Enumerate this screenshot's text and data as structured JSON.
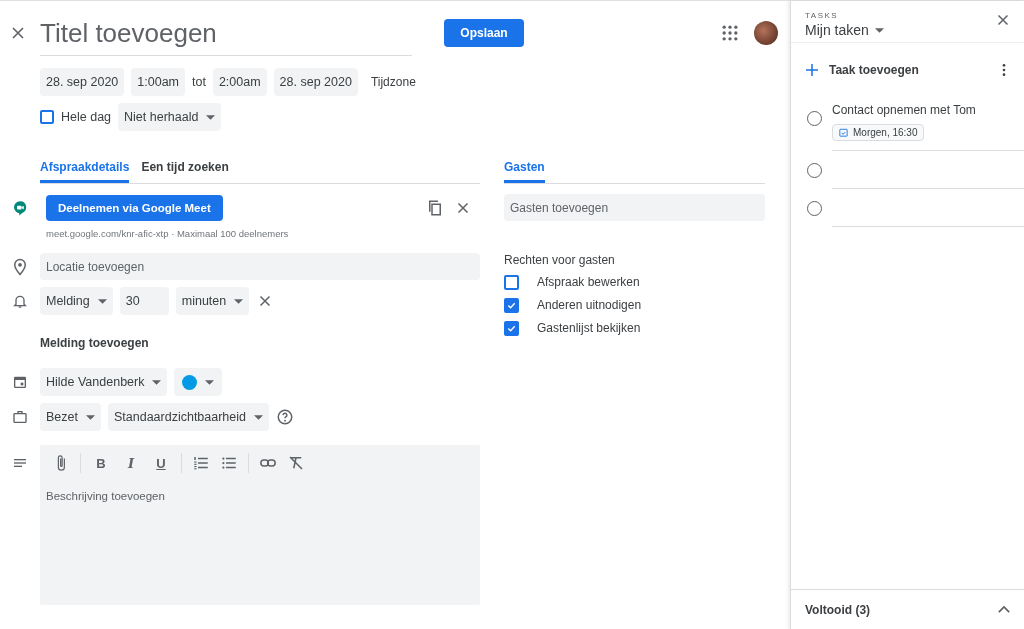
{
  "title_field": {
    "placeholder": "Titel toevoegen"
  },
  "save_button": "Opslaan",
  "time_row": {
    "start_date": "28. sep 2020",
    "start_time": "1:00am",
    "separator": "tot",
    "end_time": "2:00am",
    "end_date": "28. sep 2020",
    "timezone": "Tijdzone"
  },
  "all_day": {
    "label": "Hele dag",
    "checked": false
  },
  "repeat": "Niet herhaald",
  "tabs": [
    {
      "label": "Afspraakdetails",
      "selected": true
    },
    {
      "label": "Een tijd zoeken",
      "selected": false
    }
  ],
  "meet": {
    "button": "Deelnemen via Google Meet",
    "info": "meet.google.com/knr-afic-xtp · Maximaal 100 deelnemers"
  },
  "location": {
    "placeholder": "Locatie toevoegen"
  },
  "notification": {
    "type": "Melding",
    "value": "30",
    "unit": "minuten"
  },
  "add_notification": "Melding toevoegen",
  "calendar": {
    "owner": "Hilde Vandenberk",
    "color": "#039be5"
  },
  "availability": {
    "status": "Bezet",
    "visibility": "Standaardzichtbaarheid"
  },
  "description": {
    "placeholder": "Beschrijving toevoegen",
    "toolbar": [
      {
        "kind": "attach"
      },
      {
        "kind": "divider"
      },
      {
        "kind": "bold",
        "label": "B"
      },
      {
        "kind": "italic",
        "label": "I"
      },
      {
        "kind": "underline",
        "label": "U"
      },
      {
        "kind": "divider"
      },
      {
        "kind": "numbered"
      },
      {
        "kind": "bulleted"
      },
      {
        "kind": "divider"
      },
      {
        "kind": "link"
      },
      {
        "kind": "clear"
      }
    ]
  },
  "guests": {
    "tab": {
      "label": "Gasten",
      "selected": true
    },
    "placeholder": "Gasten toevoegen",
    "permissions_title": "Rechten voor gasten",
    "permissions": [
      {
        "label": "Afspraak bewerken",
        "checked": false
      },
      {
        "label": "Anderen uitnodigen",
        "checked": true
      },
      {
        "label": "Gastenlijst bekijken",
        "checked": true
      }
    ]
  },
  "tasks": {
    "header": "TASKS",
    "list": "Mijn taken",
    "add": "Taak toevoegen",
    "items": [
      {
        "kind": "task",
        "title": "Contact opnemen met Tom",
        "due": "Morgen, 16:30",
        "done": false
      },
      {
        "kind": "empty",
        "done": false
      },
      {
        "kind": "empty",
        "done": false
      }
    ],
    "completed": {
      "label": "Voltooid (3)",
      "expanded": false
    }
  }
}
